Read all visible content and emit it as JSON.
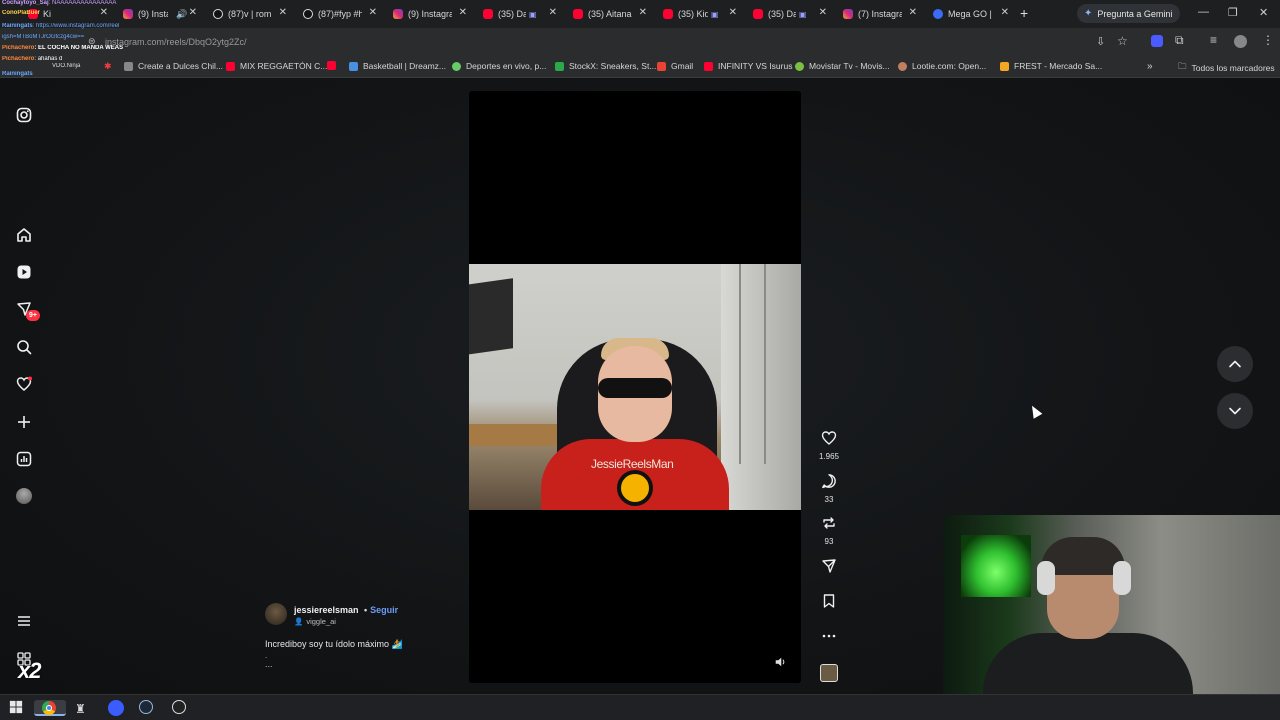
{
  "browser": {
    "tabs": [
      {
        "label": "Ki",
        "icon": "youtube-icon"
      },
      {
        "label": "(9) Insta",
        "icon": "instagram-icon",
        "audio": true
      },
      {
        "label": "(87)v | rom",
        "icon": "tiktok-icon"
      },
      {
        "label": "(87)#fyp #h",
        "icon": "tiktok-icon"
      },
      {
        "label": "(9) Instagra",
        "icon": "instagram-icon"
      },
      {
        "label": "(35) Da",
        "icon": "youtube-icon"
      },
      {
        "label": "(35) Aitana",
        "icon": "youtube-icon"
      },
      {
        "label": "(35) Kid",
        "icon": "youtube-icon"
      },
      {
        "label": "(35) Da",
        "icon": "youtube-icon"
      },
      {
        "label": "(7) Instagra",
        "icon": "instagram-icon"
      },
      {
        "label": "Mega GO |",
        "icon": "mega-icon"
      }
    ],
    "gemini_label": "Pregunta a Gemini",
    "url": "instagram.com/reels/DbqO2ytg2Zc/",
    "bookmarks": [
      {
        "label": "Create a Dulces Chil...",
        "color": "#888888"
      },
      {
        "label": "MIX REGGAETÓN C...",
        "color": "#ff0033"
      },
      {
        "label": "Basketball | Dreamz...",
        "color": "#4a90e2"
      },
      {
        "label": "Deportes en vivo, p...",
        "color": "#66cc66"
      },
      {
        "label": "StockX: Sneakers, St...",
        "color": "#2aa84a"
      },
      {
        "label": "Gmail",
        "color": "#ea4335"
      },
      {
        "label": "INFINITY VS Isurus",
        "color": "#ff0033"
      },
      {
        "label": "Movistar Tv - Movis...",
        "color": "#7ac143"
      },
      {
        "label": "Lootie.com: Open...",
        "color": "#c08060"
      },
      {
        "label": "FREST - Mercado Sa...",
        "color": "#f5a623"
      }
    ],
    "all_bookmarks_label": "Todos los marcadores",
    "more_bookmarks": "»"
  },
  "chat": [
    {
      "user": "Cochaytoyo_Saj",
      "text": ": NAAAAAAAAAAAAAAA",
      "color": "#c9a0ff"
    },
    {
      "user": "ConoPlaBuer",
      "text": "",
      "color": "#ffd24a"
    },
    {
      "user": "Rainingats",
      "text": ": https://www.instagram.com/reel",
      "color": "#6aa8ff"
    },
    {
      "user": "",
      "text": "igsh=MTBoMTJrOGtczg4cw==",
      "color": "#6aa8ff"
    },
    {
      "user": "Pichachero",
      "text": ": EL COCHA NO MANDA WEAS",
      "color": "#ff8a3a"
    },
    {
      "user": "Pichachero",
      "text": ": ahahas d",
      "color": "#ff8a3a"
    },
    {
      "user": "Rainingats",
      "text": "",
      "color": "#6aa8ff"
    }
  ],
  "chat_overlay_label": "VDO.Ninja",
  "reel": {
    "username": "jessiereelsman",
    "follow_label": "Seguir",
    "separator": "•",
    "audio": "viggle_ai",
    "caption": "Incrediboy soy tu ídolo máximo 🏄",
    "caption_dot": ".",
    "caption_more": "...",
    "shirt_text": "JessieReelsMan",
    "likes": "1.965",
    "comments": "33",
    "reposts": "93"
  },
  "sidebar": {
    "notification_badge": "9+"
  },
  "overlay": {
    "multiplier": "x2"
  }
}
